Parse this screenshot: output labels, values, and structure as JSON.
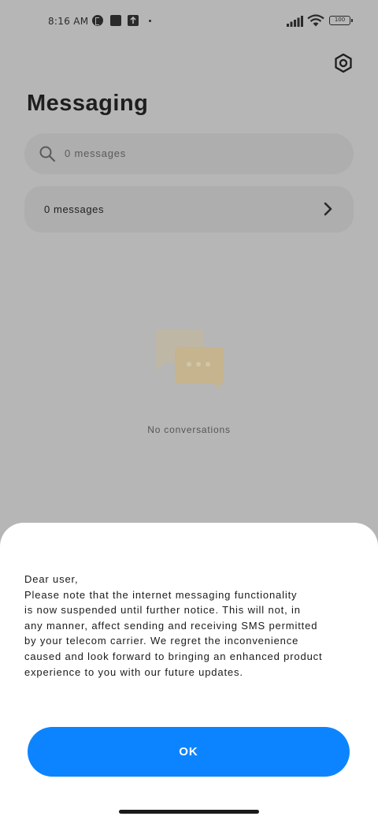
{
  "status_bar": {
    "time": "8:16 AM",
    "battery": "100",
    "icons": [
      "p-app-icon",
      "square-app-icon",
      "upload-icon",
      "dot-icon",
      "signal-icon",
      "wifi-icon",
      "battery-icon"
    ]
  },
  "header": {
    "title": "Messaging",
    "settings_icon": "gear-icon"
  },
  "search": {
    "placeholder": "0 messages",
    "icon": "search-icon"
  },
  "messages_row": {
    "label": "0 messages",
    "icon": "chevron-right-icon"
  },
  "empty_state": {
    "icon": "chat-bubbles-icon",
    "text": "No conversations"
  },
  "dialog": {
    "message": "Dear user,\nPlease note that the internet messaging functionality\nis now suspended until further notice. This will not, in\nany manner, affect sending and receiving SMS permitted\nby your telecom carrier. We regret the inconvenience\ncaused and look forward to bringing an enhanced product\nexperience to you with our future updates.",
    "ok_label": "OK"
  },
  "colors": {
    "accent": "#0d84ff",
    "scrim_background": "#b6b6b6"
  }
}
